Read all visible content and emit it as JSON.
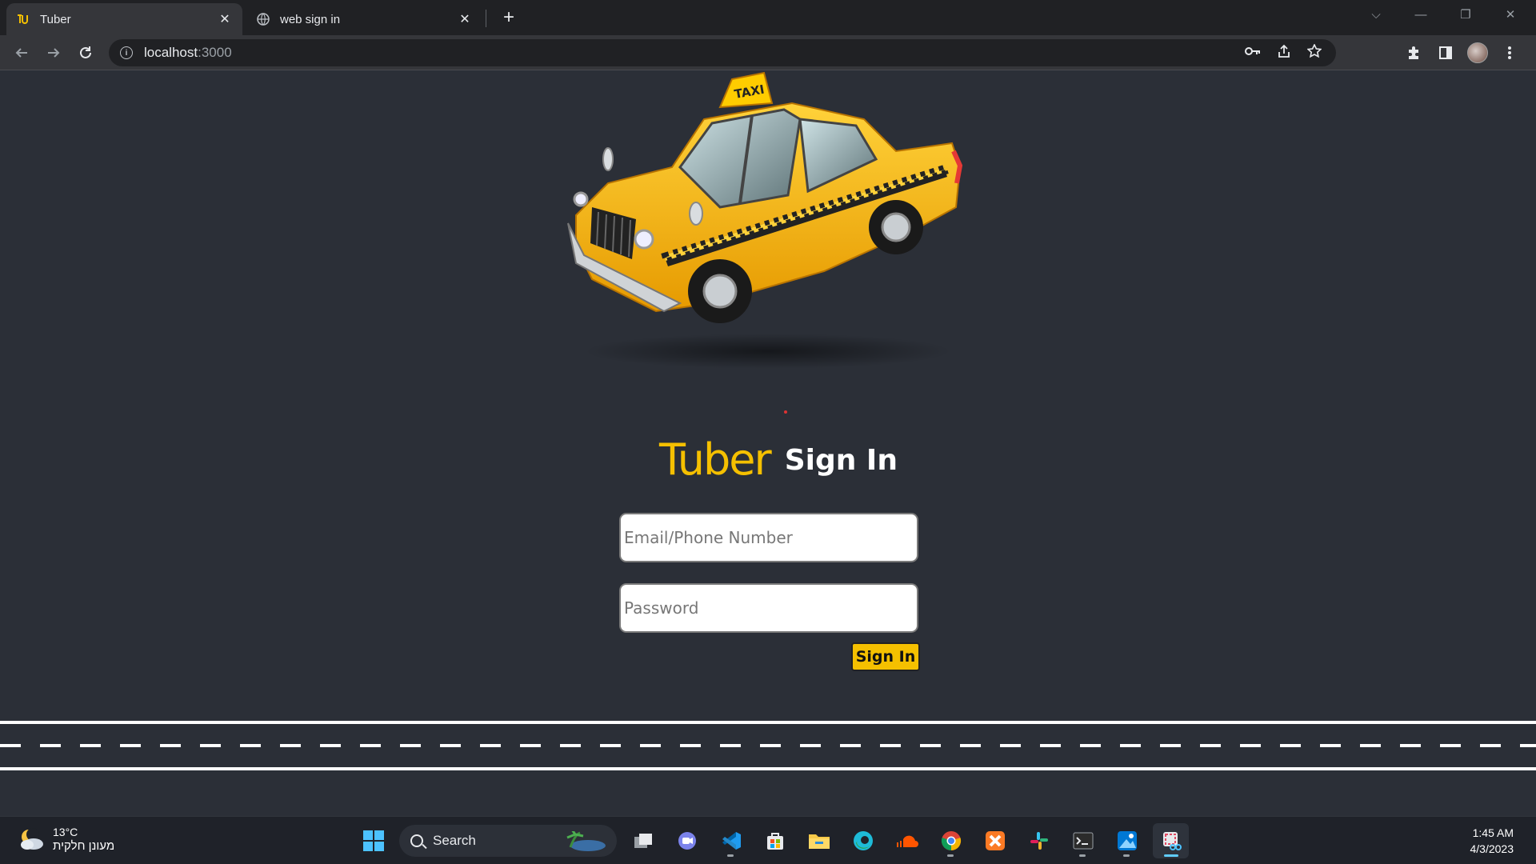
{
  "browser": {
    "tabs": [
      {
        "title": "Tuber",
        "favicon": "tuber-logo-icon",
        "active": true
      },
      {
        "title": "web sign in",
        "favicon": "globe-icon",
        "active": false
      }
    ],
    "new_tab_label": "+",
    "url_host": "localhost",
    "url_port": ":3000"
  },
  "page": {
    "hero_image": "taxi-car-illustration",
    "logo_text": "Tuber",
    "heading": "Sign In",
    "email_placeholder": "Email/Phone Number",
    "password_placeholder": "Password",
    "signin_button": "Sign In",
    "colors": {
      "accent": "#f5c000",
      "background": "#2b2f37"
    }
  },
  "taskbar": {
    "weather_temp": "13°C",
    "weather_condition": "מעונן חלקית",
    "search_label": "Search",
    "time": "1:45 AM",
    "date": "4/3/2023"
  }
}
